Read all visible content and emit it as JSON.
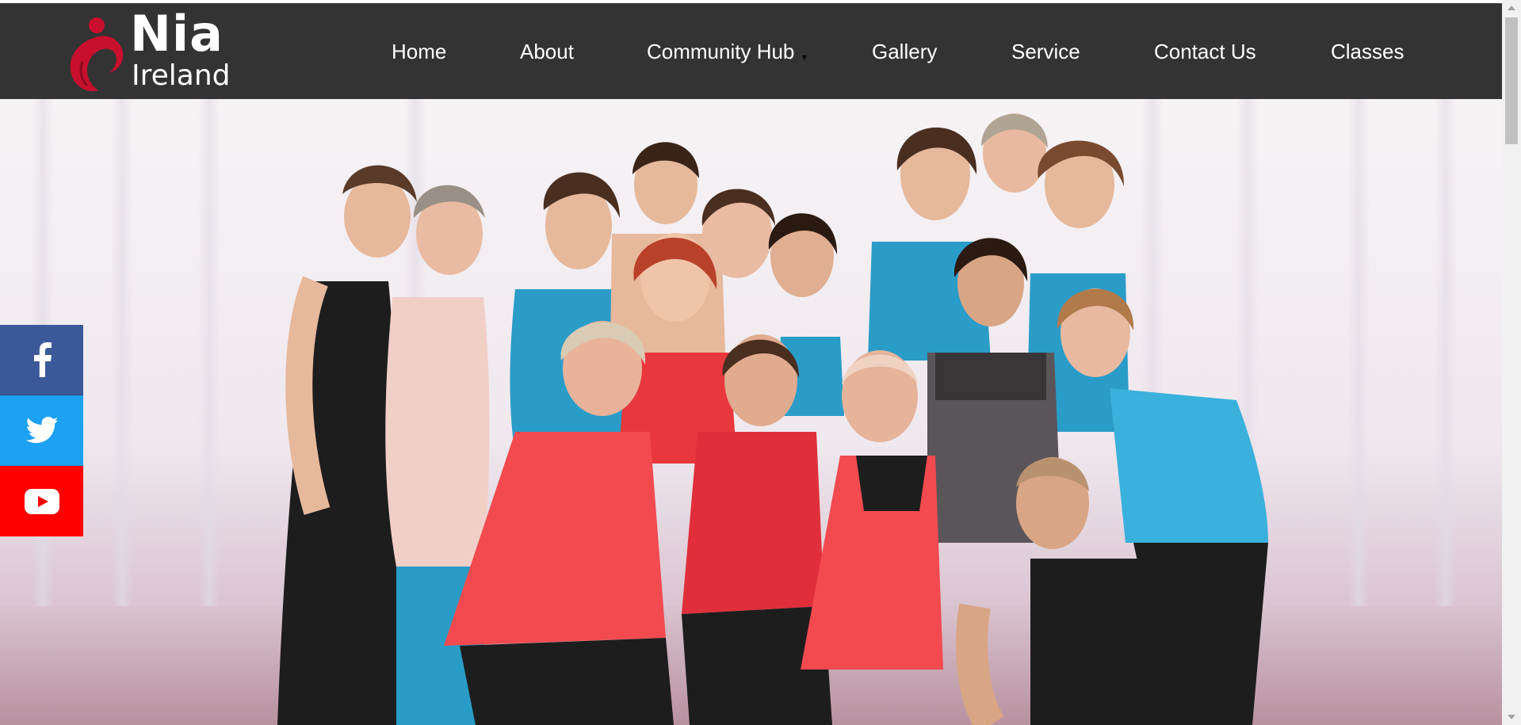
{
  "brand": {
    "name": "Nia",
    "subtitle": "Ireland",
    "colors": {
      "nav_bg": "#333333",
      "logo_red": "#c8102e",
      "nav_text": "#ffffff"
    }
  },
  "nav": {
    "items": [
      {
        "label": "Home"
      },
      {
        "label": "About"
      },
      {
        "label": "Community Hub",
        "has_dropdown": true
      },
      {
        "label": "Gallery"
      },
      {
        "label": "Service"
      },
      {
        "label": "Contact Us"
      },
      {
        "label": "Classes"
      }
    ],
    "dropdown_caret": "▾"
  },
  "hero": {
    "image": "group-photo-of-nia-dancers",
    "colors": {
      "outfit_red": "#e8383d",
      "outfit_blue": "#2a9cc8",
      "outfit_black": "#1d1d1d",
      "outfit_grey": "#5a5558"
    }
  },
  "social": {
    "items": [
      {
        "icon": "facebook-icon",
        "color": "#3b5998"
      },
      {
        "icon": "twitter-icon",
        "color": "#1da1f2"
      },
      {
        "icon": "youtube-icon",
        "color": "#ff0000"
      }
    ]
  }
}
